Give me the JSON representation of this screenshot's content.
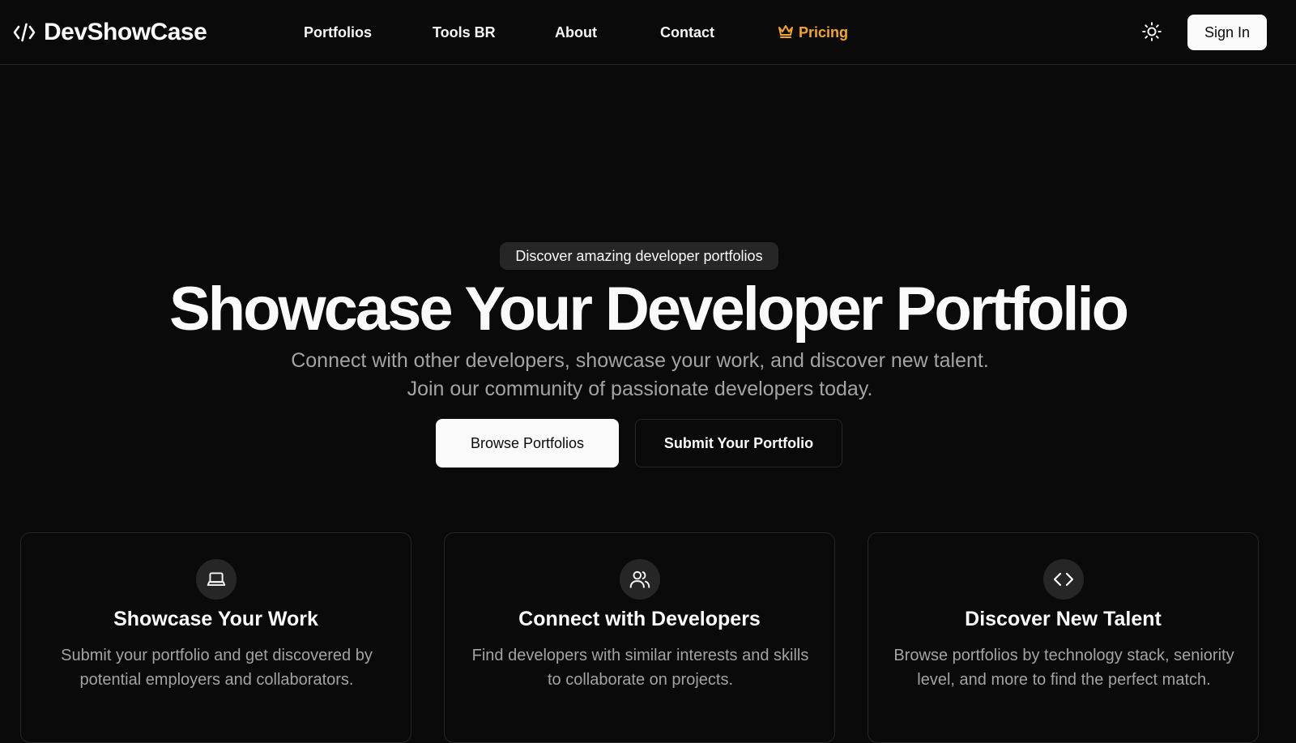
{
  "brand": {
    "name": "DevShowCase",
    "icon": "code-slash-icon"
  },
  "nav": {
    "items": [
      {
        "label": "Portfolios"
      },
      {
        "label": "Tools BR"
      },
      {
        "label": "About"
      },
      {
        "label": "Contact"
      },
      {
        "label": "Pricing",
        "icon": "crown-icon",
        "color": "#f5a623"
      }
    ]
  },
  "header": {
    "theme_icon": "sun-icon",
    "sign_in_label": "Sign In"
  },
  "hero": {
    "badge": "Discover amazing developer portfolios",
    "title": "Showcase Your Developer Portfolio",
    "subtitle": "Connect with other developers, showcase your work, and discover new talent. Join our community of passionate developers today.",
    "primary_button": "Browse Portfolios",
    "secondary_button": "Submit Your Portfolio"
  },
  "features": [
    {
      "icon": "laptop-icon",
      "title": "Showcase Your Work",
      "description": "Submit your portfolio and get discovered by potential employers and collaborators."
    },
    {
      "icon": "users-icon",
      "title": "Connect with Developers",
      "description": "Find developers with similar interests and skills to collaborate on projects."
    },
    {
      "icon": "code-icon",
      "title": "Discover New Talent",
      "description": "Browse portfolios by technology stack, seniority level, and more to find the perfect match."
    }
  ],
  "colors": {
    "background": "#0a0a0a",
    "foreground": "#fafafa",
    "muted": "#a3a3a3",
    "border": "#262626",
    "accent": "#f5a623"
  }
}
